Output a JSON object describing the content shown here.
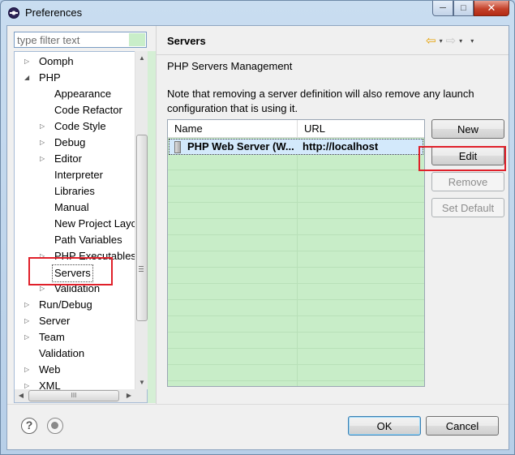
{
  "window": {
    "title": "Preferences"
  },
  "titlebar_buttons": {
    "minimize": "─",
    "maximize": "□",
    "close": "✕"
  },
  "filter": {
    "placeholder": "type filter text"
  },
  "tree": {
    "items": [
      {
        "label": "Oomph",
        "level": 0,
        "twisty": "▷"
      },
      {
        "label": "PHP",
        "level": 0,
        "twisty": "◢"
      },
      {
        "label": "Appearance",
        "level": 1,
        "twisty": ""
      },
      {
        "label": "Code Refactor",
        "level": 1,
        "twisty": ""
      },
      {
        "label": "Code Style",
        "level": 1,
        "twisty": "▷"
      },
      {
        "label": "Debug",
        "level": 1,
        "twisty": "▷"
      },
      {
        "label": "Editor",
        "level": 1,
        "twisty": "▷"
      },
      {
        "label": "Interpreter",
        "level": 1,
        "twisty": ""
      },
      {
        "label": "Libraries",
        "level": 1,
        "twisty": ""
      },
      {
        "label": "Manual",
        "level": 1,
        "twisty": ""
      },
      {
        "label": "New Project Layout",
        "level": 1,
        "twisty": ""
      },
      {
        "label": "Path Variables",
        "level": 1,
        "twisty": ""
      },
      {
        "label": "PHP Executables",
        "level": 1,
        "twisty": "▷"
      },
      {
        "label": "Servers",
        "level": 1,
        "twisty": "",
        "selected": true
      },
      {
        "label": "Validation",
        "level": 1,
        "twisty": "▷"
      },
      {
        "label": "Run/Debug",
        "level": 0,
        "twisty": "▷"
      },
      {
        "label": "Server",
        "level": 0,
        "twisty": "▷"
      },
      {
        "label": "Team",
        "level": 0,
        "twisty": "▷"
      },
      {
        "label": "Validation",
        "level": 0,
        "twisty": ""
      },
      {
        "label": "Web",
        "level": 0,
        "twisty": "▷"
      },
      {
        "label": "XML",
        "level": 0,
        "twisty": "▷"
      }
    ],
    "hscroll_grip": "III"
  },
  "page": {
    "title": "Servers",
    "subtitle": "PHP Servers Management",
    "note": "Note that removing a server definition will also remove any launch configuration that is using it."
  },
  "table": {
    "columns": [
      "Name",
      "URL"
    ],
    "rows": [
      {
        "name": "PHP Web Server (W...",
        "url": "http://localhost"
      }
    ]
  },
  "buttons": {
    "new": "New",
    "edit": "Edit",
    "remove": "Remove",
    "set_default": "Set Default",
    "ok": "OK",
    "cancel": "Cancel"
  },
  "nav_icons": {
    "back": "⇦",
    "forward": "⇨",
    "dropdown": "▾",
    "menu": "▾"
  },
  "footer_icons": {
    "help": "?"
  },
  "colors": {
    "highlight": "#e0202a",
    "table_bg": "#c8edc8",
    "back_arrow": "#e6a000"
  }
}
